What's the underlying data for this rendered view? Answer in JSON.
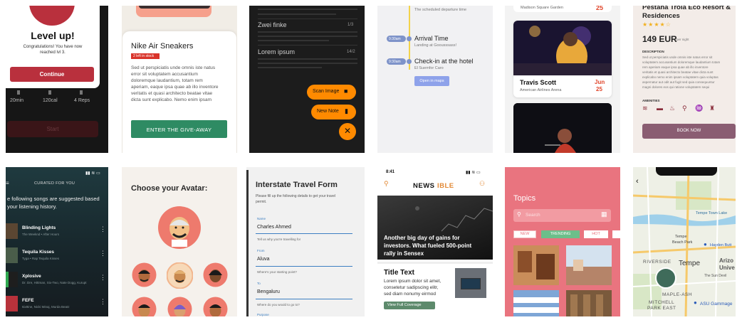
{
  "cards": {
    "level": {
      "title": "Level up!",
      "message_1": "Congratulations! You have now",
      "message_2": "reached lvl 3.",
      "button": "Continue",
      "stats": [
        "20min",
        "120cal",
        "4 Reps"
      ],
      "start": "Start"
    },
    "sneaker": {
      "title": "Nike Air Sneakers",
      "badge": "2 left in stock",
      "body": [
        "Sed ut perspiciatis unde omnis iste natus",
        "error sit voluptatem accusantium",
        "doloremque laudantium, totam rem",
        "aperiam, eaque ipsa quae ab illo inventore",
        "veritatis et quasi architecto beatae vitae",
        "dicta sunt explicabo. Nemo enim ipsam"
      ],
      "button": "ENTER THE GIVE-AWAY"
    },
    "notes": {
      "rows": [
        {
          "title": "Zwei finke",
          "count": "1/3"
        },
        {
          "title": "Lorem ipsum",
          "count": "14/2"
        }
      ],
      "scan_label": "Scan Image",
      "note_label": "New Note"
    },
    "itinerary": {
      "top_sub": "The scheduled departure time",
      "items": [
        {
          "time": "9:30am",
          "title": "Arrival Time",
          "sub": "Landing at Goousssass!"
        },
        {
          "time": "9:30am",
          "title": "Check-in at the hotel",
          "sub": "El Suemfor Caro"
        }
      ],
      "button": "Open in maps"
    },
    "concert": {
      "top_place": "Madison Square Garden",
      "top_day": "25",
      "artist": "Travis Scott",
      "venue": "American Airlines Arena",
      "month": "Jun",
      "day": "25"
    },
    "hotel": {
      "title": "Pestana Troia Eco Resort &",
      "title_2": "Residences",
      "stars": "★★★★☆",
      "price": "149 EUR",
      "per_night": "per night",
      "desc_head": "DESCRIPTION",
      "desc": [
        "Sed ut perspiciatis unde omnis iste natus error sit",
        "voluptatem accusantium doloremque laudantium totam",
        "rem aperiam eaque ipsa quae ab illo inventore",
        "veritatis et quasi architecto beatae vitae dicta sunt",
        "explicabo nemo enim ipsam voluptatem quia voluptas",
        "aspernatur aut odit aut fugit sed quia consequuntur",
        "magni dolores eos qui ratione voluptatem sequi"
      ],
      "amenities_head": "AMENITIES",
      "button": "BOOK NOW"
    },
    "music": {
      "header": "CURATED FOR YOU",
      "intro_1": "e following songs are suggested based",
      "intro_2": "your listening history.",
      "songs": [
        {
          "title": "Blinding Lights",
          "artist": "The Weeknd • After Hours"
        },
        {
          "title": "Tequila Kisses",
          "artist": "Tyga • Rap Tequila Kisses"
        },
        {
          "title": "Xplosive",
          "artist": "Dr. Dre, Hittman, Six-Two, Nate Dogg, Kurupt"
        },
        {
          "title": "FEFE",
          "artist": "6ix9ine, Nicki Minaj, Murda Beatz"
        }
      ]
    },
    "avatar": {
      "title": "Choose your Avatar:"
    },
    "travel": {
      "title": "Interstate Travel Form",
      "intro_1": "Please fill up the following details to get your travel",
      "intro_2": "permit.",
      "fields": [
        {
          "label": "Name",
          "value": "Charles Ahmed",
          "hint": "Tell us why you're travelling for"
        },
        {
          "label": "From",
          "value": "Aluva",
          "hint": "Where's your starting point?"
        },
        {
          "label": "To",
          "value": "Bengaluru",
          "hint": "Where do you would to go to?"
        }
      ],
      "last_label": "Purpose"
    },
    "news": {
      "time": "8:41",
      "brand_a": "NEWS",
      "brand_b": "IBLE",
      "headline_1": "Another big day of gains for",
      "headline_2": "investors. What fueled 500-point",
      "headline_3": "rally in Sensex",
      "article_title": "Title Text",
      "article_body": [
        "Lorem ipsum dolor sit amet,",
        "consetetur sadipscing elitr,",
        "sed diam nonumy eirmod"
      ],
      "coverage": "View Full Coverage"
    },
    "topics": {
      "title": "Topics",
      "search_placeholder": "Search",
      "tabs": [
        "NEW",
        "TRENDING",
        "HOT"
      ]
    },
    "map": {
      "labels": [
        "Tempe Town Lake",
        "Tempe",
        "Beach Park",
        "Hayden Butt",
        "RIVERSIDE",
        "MAPLE-ASH",
        "MITCHELL",
        "PARK EAST",
        "ASU Gammage",
        "Arizo",
        "Unive",
        "Tempe",
        "The Sun Devil"
      ]
    }
  },
  "colors": {
    "red": "#b9303d",
    "green": "#2e8b63",
    "orange": "#ff8a00",
    "itin_accent": "#7e93c9",
    "concert_red": "#e0452a",
    "hotel_btn": "#8a5d72",
    "news_orange": "#e28936",
    "topics_bg": "#e9747f"
  }
}
